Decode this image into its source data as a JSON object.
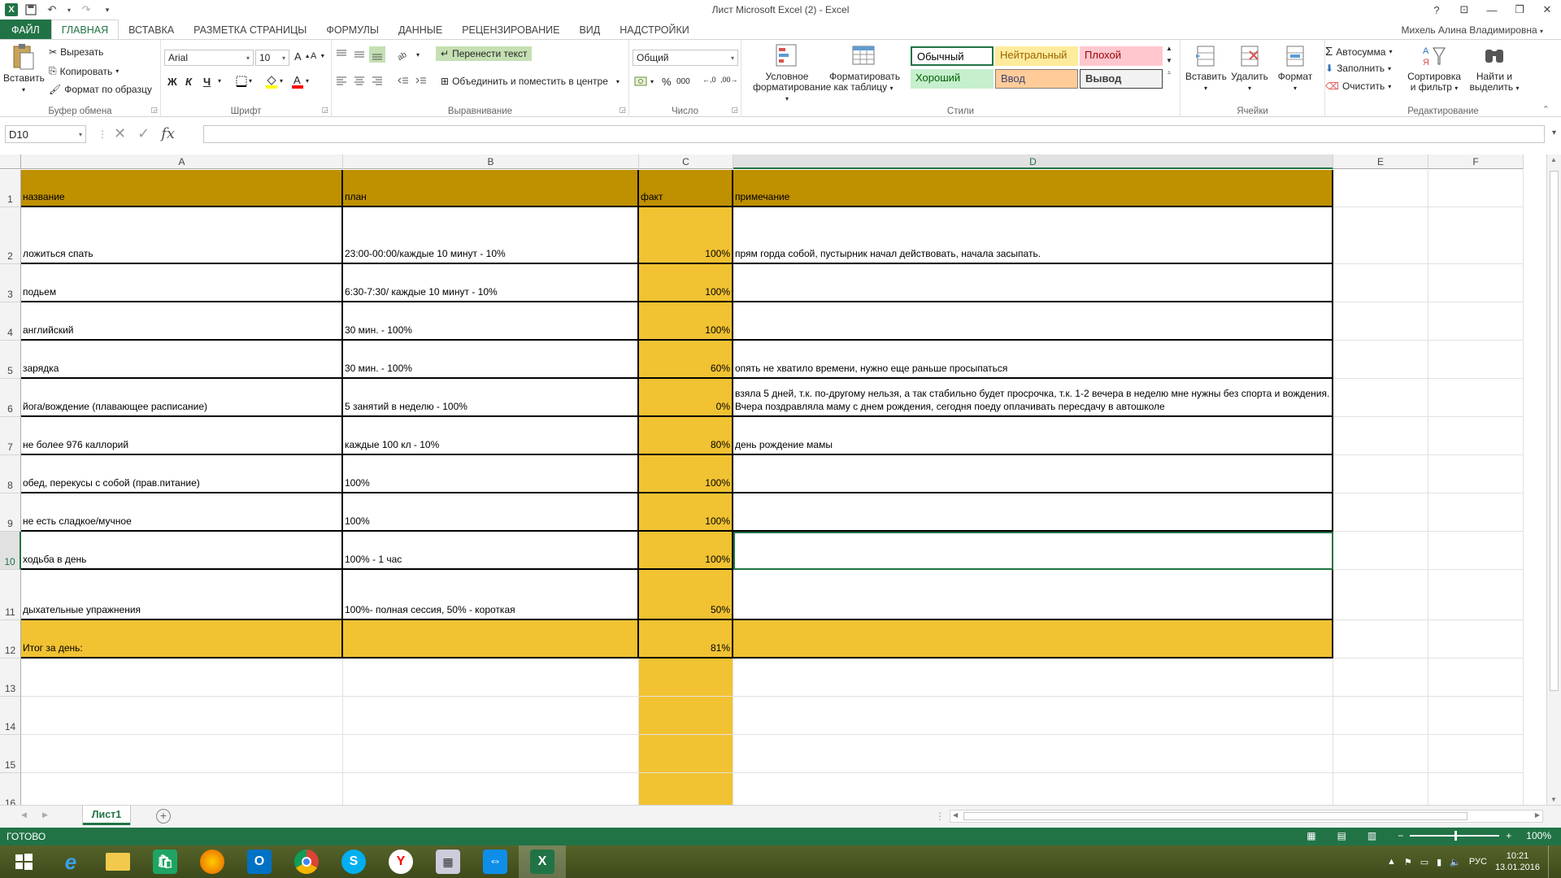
{
  "window": {
    "title": "Лист Microsoft Excel (2) - Excel",
    "controls": [
      "?",
      "⊡",
      "—",
      "❐",
      "✕"
    ]
  },
  "ribbon_tabs": [
    "ФАЙЛ",
    "ГЛАВНАЯ",
    "ВСТАВКА",
    "РАЗМЕТКА СТРАНИЦЫ",
    "ФОРМУЛЫ",
    "ДАННЫЕ",
    "РЕЦЕНЗИРОВАНИЕ",
    "ВИД",
    "НАДСТРОЙКИ"
  ],
  "user_name": "Михель Алина Владимировна",
  "clipboard": {
    "paste": "Вставить",
    "cut": "Вырезать",
    "copy": "Копировать",
    "format_painter": "Формат по образцу",
    "label": "Буфер обмена"
  },
  "font": {
    "name": "Arial",
    "size": "10",
    "bold": "Ж",
    "italic": "К",
    "underline": "Ч",
    "label": "Шрифт"
  },
  "alignment": {
    "wrap_text": "Перенести текст",
    "merge_center": "Объединить и поместить в центре",
    "label": "Выравнивание"
  },
  "number": {
    "format": "Общий",
    "label": "Число"
  },
  "styles": {
    "conditional": "Условное форматирование",
    "format_as_table": "Форматировать как таблицу",
    "cells": [
      {
        "label": "Обычный",
        "bg": "#ffffff",
        "color": "#000000"
      },
      {
        "label": "Нейтральный",
        "bg": "#ffeb9c",
        "color": "#9c6500"
      },
      {
        "label": "Плохой",
        "bg": "#ffc7ce",
        "color": "#9c0006"
      },
      {
        "label": "Хороший",
        "bg": "#c6efce",
        "color": "#006100"
      },
      {
        "label": "Ввод",
        "bg": "#ffcc99",
        "color": "#3f3f76"
      },
      {
        "label": "Вывод",
        "bg": "#f2f2f2",
        "color": "#3f3f3f"
      }
    ],
    "label": "Стили"
  },
  "cells_group": {
    "insert": "Вставить",
    "delete": "Удалить",
    "format": "Формат",
    "label": "Ячейки"
  },
  "editing": {
    "autosum": "Автосумма",
    "fill": "Заполнить",
    "clear": "Очистить",
    "sort_filter": "Сортировка и фильтр",
    "find_select": "Найти и выделить",
    "label": "Редактирование"
  },
  "formula_bar": {
    "name_box": "D10",
    "formula": ""
  },
  "columns": [
    "A",
    "B",
    "C",
    "D",
    "E",
    "F"
  ],
  "selected_column": "D",
  "selected_row": "10",
  "rows": [
    {
      "num": "1",
      "a": "название",
      "b": "план",
      "c": "факт",
      "d": "примечание"
    },
    {
      "num": "2",
      "a": "ложиться спать",
      "b": "23:00-00:00/каждые 10 минут - 10%",
      "c": "100%",
      "d": "прям горда собой, пустырник начал действовать, начала засыпать."
    },
    {
      "num": "3",
      "a": "подьем",
      "b": "6:30-7:30/ каждые 10 минут - 10%",
      "c": "100%",
      "d": ""
    },
    {
      "num": "4",
      "a": "английский",
      "b": "30 мин. - 100%",
      "c": "100%",
      "d": ""
    },
    {
      "num": "5",
      "a": "зарядка",
      "b": "30 мин. - 100%",
      "c": "60%",
      "d": "опять не хватило времени, нужно еще раньше просыпаться"
    },
    {
      "num": "6",
      "a": "йога/вождение (плавающее расписание)",
      "b": "5 занятий в неделю - 100%",
      "c": "0%",
      "d": "взяла 5 дней, т.к. по-другому нельзя, а так стабильно будет просрочка, т.к. 1-2 вечера в неделю мне нужны без спорта и вождения. Вчера поздравляла маму с днем рождения, сегодня поеду оплачивать пересдачу в автошколе"
    },
    {
      "num": "7",
      "a": "не более 976 каллорий",
      "b": "каждые 100 кл - 10%",
      "c": "80%",
      "d": "день рождение мамы"
    },
    {
      "num": "8",
      "a": "обед, перекусы с собой (прав.питание)",
      "b": "100%",
      "c": "100%",
      "d": ""
    },
    {
      "num": "9",
      "a": "не есть сладкое/мучное",
      "b": "100%",
      "c": "100%",
      "d": ""
    },
    {
      "num": "10",
      "a": "ходьба в день",
      "b": "100% - 1 час",
      "c": "100%",
      "d": ""
    },
    {
      "num": "11",
      "a": "дыхательные упражнения",
      "b": "100%- полная сессия, 50% - короткая",
      "c": "50%",
      "d": ""
    },
    {
      "num": "12",
      "a": "Итог за день:",
      "b": "",
      "c": "81%",
      "d": ""
    },
    {
      "num": "13",
      "a": "",
      "b": "",
      "c": "",
      "d": ""
    },
    {
      "num": "14",
      "a": "",
      "b": "",
      "c": "",
      "d": ""
    },
    {
      "num": "15",
      "a": "",
      "b": "",
      "c": "",
      "d": ""
    },
    {
      "num": "16",
      "a": "",
      "b": "",
      "c": "",
      "d": ""
    }
  ],
  "sheet_tab": "Лист1",
  "status": {
    "ready": "ГОТОВО",
    "zoom": "100%"
  },
  "taskbar": {
    "apps": [
      "start-icon",
      "ie-icon",
      "explorer-icon",
      "store-icon",
      "firefox-icon",
      "outlook-icon",
      "chrome-icon",
      "skype-icon",
      "yandex-icon",
      "calculator-icon",
      "teamviewer-icon",
      "excel-icon"
    ],
    "lang": "РУС",
    "time": "10:21",
    "date": "13.01.2016"
  },
  "colors": {
    "accent": "#217346",
    "header_fill": "#bf9000",
    "fact_fill": "#f1c232"
  }
}
